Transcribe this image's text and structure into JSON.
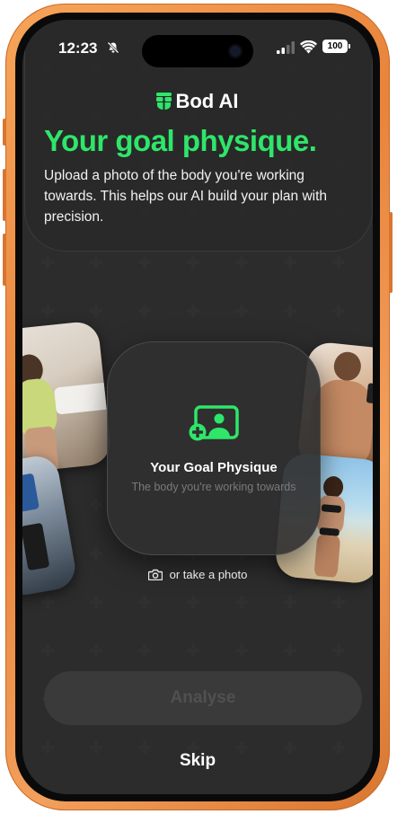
{
  "status_bar": {
    "time": "12:23",
    "battery": "100",
    "icons": [
      "bell-slash-icon",
      "signal-icon",
      "wifi-icon",
      "battery-icon"
    ]
  },
  "brand": {
    "name": "Bod AI",
    "logo_icon": "bod-logo-icon",
    "color": "#ffffff"
  },
  "header": {
    "title": "Your goal physique.",
    "subtitle": "Upload a photo of the body you're working towards. This helps our AI build your plan with precision.",
    "title_color": "#2ee66a"
  },
  "upload_card": {
    "icon": "add-photo-icon",
    "title": "Your Goal Physique",
    "subtitle": "The body you're working towards"
  },
  "take_photo": {
    "icon": "camera-icon",
    "label": "or take a photo"
  },
  "actions": {
    "analyse_label": "Analyse",
    "skip_label": "Skip"
  },
  "colors": {
    "accent": "#2ee66a",
    "background": "#1e1e1e",
    "frame": "#e9833b"
  }
}
